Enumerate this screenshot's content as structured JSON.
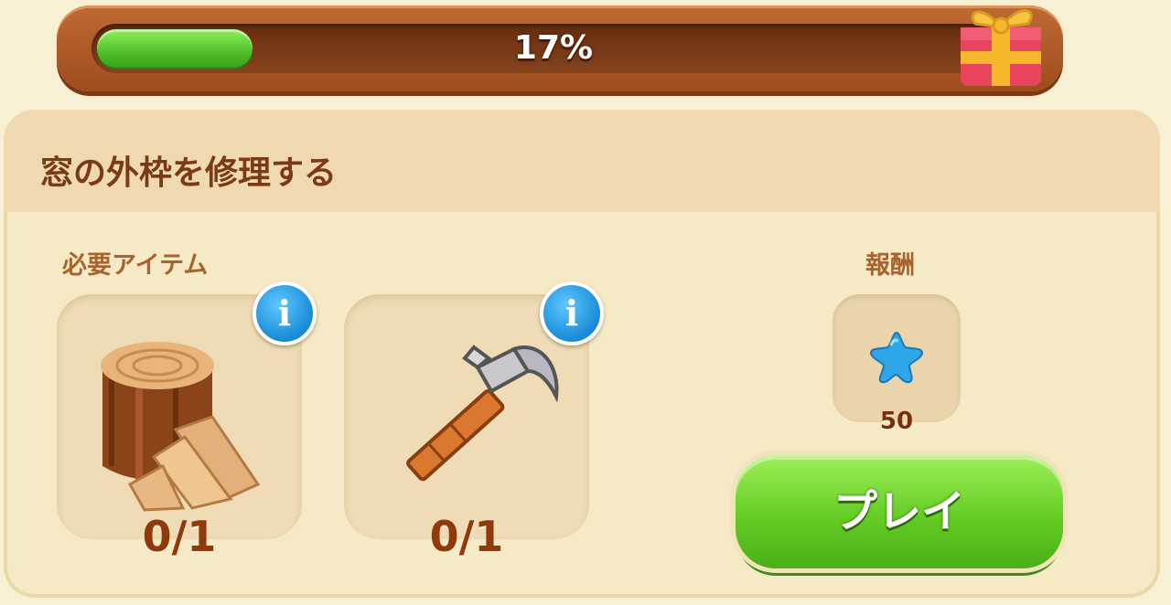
{
  "progress": {
    "percent_label": "17%",
    "fraction": 0.17
  },
  "task": {
    "title": "窓の外枠を修理する",
    "required_label": "必要アイテム",
    "reward_label": "報酬",
    "items": [
      {
        "icon": "wood-logs-icon",
        "count": "0/1"
      },
      {
        "icon": "hammer-icon",
        "count": "0/1"
      }
    ],
    "reward": {
      "icon": "blue-star-icon",
      "amount": "50"
    },
    "play_label": "プレイ"
  },
  "colors": {
    "progress_fill": "#5cc92e",
    "play_button": "#64cc24",
    "title_text": "#7a3a14",
    "info_button": "#1a8ad6"
  }
}
